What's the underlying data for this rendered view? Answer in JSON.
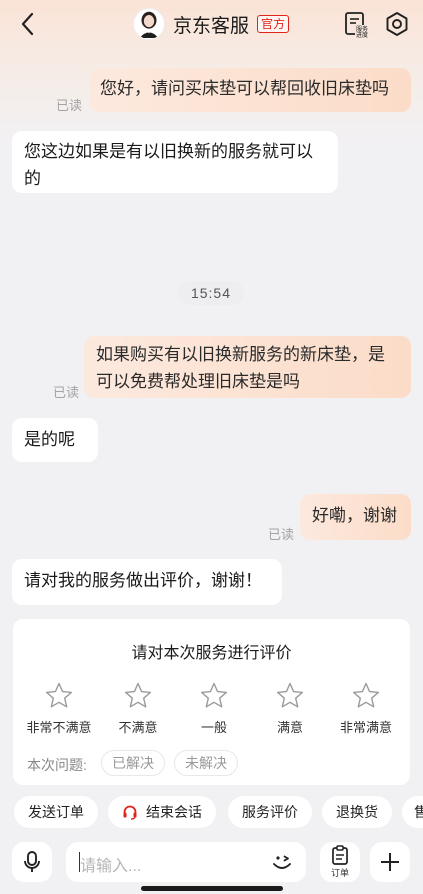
{
  "header": {
    "title": "京东客服",
    "badge": "官方",
    "progress_label_line1": "服务",
    "progress_label_line2": "进度"
  },
  "messages": [
    {
      "side": "me",
      "text": "您好，请问买床垫可以帮回收旧床垫吗",
      "status": "已读"
    },
    {
      "side": "them",
      "line1": "您这边如果是有以旧换新的服务就可以",
      "line2": "的"
    },
    {
      "side": "me",
      "line1": "如果购买有以旧换新服务的新床垫，是",
      "line2": "可以免费帮处理旧床垫是吗",
      "status": "已读"
    },
    {
      "side": "them",
      "text": "是的呢"
    },
    {
      "side": "me",
      "text": "好嘞，谢谢",
      "status": "已读"
    },
    {
      "side": "them",
      "text": "请对我的服务做出评价，谢谢！"
    }
  ],
  "timestamp": "15:54",
  "rating": {
    "title": "请对本次服务进行评价",
    "options": [
      "非常不满意",
      "不满意",
      "一般",
      "满意",
      "非常满意"
    ],
    "question_label": "本次问题:",
    "chips": [
      "已解决",
      "未解决"
    ]
  },
  "quick_actions": [
    "发送订单",
    "结束会话",
    "服务评价",
    "退换货",
    "售"
  ],
  "input": {
    "placeholder": "请输入...",
    "order_label": "订单"
  },
  "colors": {
    "accent": "#e2231a",
    "my_bubble": "#fbdcc8",
    "background": "#f1f1f4"
  }
}
